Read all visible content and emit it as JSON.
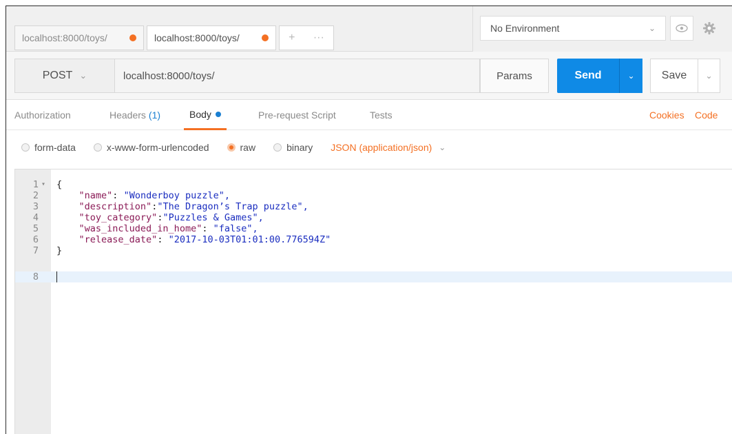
{
  "tabs": [
    {
      "label": "localhost:8000/toys/",
      "active": false
    },
    {
      "label": "localhost:8000/toys/",
      "active": true
    }
  ],
  "new_tab": {
    "plus": "+",
    "more": "···"
  },
  "environment": {
    "selected": "No Environment"
  },
  "request": {
    "method": "POST",
    "url": "localhost:8000/toys/",
    "params_label": "Params",
    "send_label": "Send",
    "save_label": "Save"
  },
  "subtabs": {
    "authorization": "Authorization",
    "headers": "Headers",
    "headers_count": "(1)",
    "body": "Body",
    "prerequest": "Pre-request Script",
    "tests": "Tests",
    "cookies": "Cookies",
    "code": "Code"
  },
  "body_types": {
    "form_data": "form-data",
    "urlencoded": "x-www-form-urlencoded",
    "raw": "raw",
    "binary": "binary",
    "selected": "raw",
    "content_type": "JSON (application/json)"
  },
  "editor": {
    "line_numbers": [
      "1",
      "2",
      "3",
      "4",
      "5",
      "6",
      "7",
      "8"
    ],
    "open_brace": "{",
    "close_brace": "}",
    "fields": [
      {
        "key": "\"name\"",
        "sep": ": ",
        "value": "\"Wonderboy puzzle\","
      },
      {
        "key": "\"description\"",
        "sep": ":",
        "value": "\"The Dragon’s Trap puzzle\","
      },
      {
        "key": "\"toy_category\"",
        "sep": ":",
        "value": "\"Puzzles & Games\","
      },
      {
        "key": "\"was_included_in_home\"",
        "sep": ": ",
        "value": "\"false\","
      },
      {
        "key": "\"release_date\"",
        "sep": ": ",
        "value": "\"2017-10-03T01:01:00.776594Z\""
      }
    ],
    "current_line": 8
  },
  "colors": {
    "accent_orange": "#f47023",
    "send_blue": "#0f8ae6",
    "json_key": "#8a1a56",
    "json_string": "#1a2dbf"
  },
  "icons": [
    "chevron-down-icon",
    "eye-icon",
    "gear-icon",
    "plus-icon",
    "more-icon",
    "fold-arrow-icon"
  ]
}
